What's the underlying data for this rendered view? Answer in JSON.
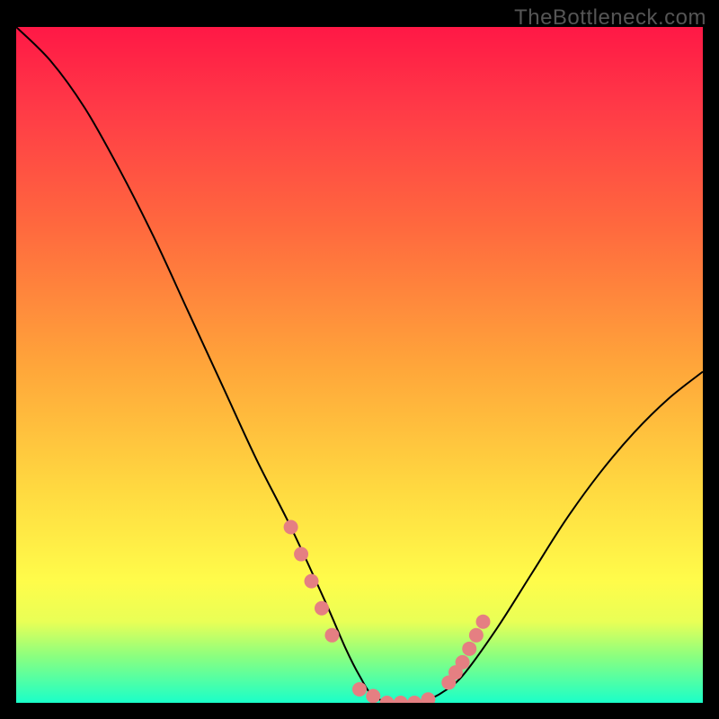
{
  "watermark": "TheBottleneck.com",
  "chart_data": {
    "type": "line",
    "title": "",
    "xlabel": "",
    "ylabel": "",
    "xlim": [
      0,
      100
    ],
    "ylim": [
      0,
      100
    ],
    "series": [
      {
        "name": "bottleneck-curve",
        "x": [
          0,
          5,
          10,
          15,
          20,
          25,
          30,
          35,
          40,
          45,
          48,
          50,
          52,
          55,
          58,
          60,
          62,
          65,
          70,
          75,
          80,
          85,
          90,
          95,
          100
        ],
        "y": [
          100,
          95,
          88,
          79,
          69,
          58,
          47,
          36,
          26,
          15,
          8,
          4,
          1,
          0,
          0,
          0.5,
          1.5,
          4,
          11,
          19,
          27,
          34,
          40,
          45,
          49
        ]
      }
    ],
    "markers": {
      "name": "highlight-points",
      "color": "#e57f82",
      "x": [
        40,
        41.5,
        43,
        44.5,
        46,
        50,
        52,
        54,
        56,
        58,
        60,
        63,
        64,
        65,
        66,
        67,
        68
      ],
      "y": [
        26,
        22,
        18,
        14,
        10,
        2,
        1,
        0,
        0,
        0,
        0.5,
        3,
        4.5,
        6,
        8,
        10,
        12
      ]
    },
    "gradient_stops": [
      {
        "pos": 0,
        "color": "#ff1846"
      },
      {
        "pos": 12,
        "color": "#ff3a47"
      },
      {
        "pos": 30,
        "color": "#ff6a3e"
      },
      {
        "pos": 50,
        "color": "#ffa53a"
      },
      {
        "pos": 68,
        "color": "#ffd840"
      },
      {
        "pos": 82,
        "color": "#fffc4a"
      },
      {
        "pos": 88,
        "color": "#e9ff56"
      },
      {
        "pos": 93,
        "color": "#8dff7e"
      },
      {
        "pos": 100,
        "color": "#1affc9"
      }
    ]
  }
}
